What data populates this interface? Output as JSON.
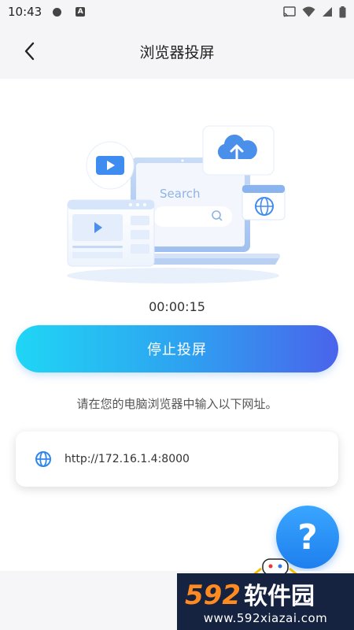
{
  "status_bar": {
    "time": "10:43",
    "a_badge": "A",
    "icons": [
      "record-dot-icon",
      "a-badge-icon",
      "cast-icon",
      "wifi-icon",
      "signal-icon",
      "battery-icon"
    ]
  },
  "header": {
    "title": "浏览器投屏",
    "back_icon": "chevron-left-icon"
  },
  "illustration": {
    "search_placeholder": "Search",
    "icons": [
      "play-icon",
      "cloud-upload-icon",
      "globe-icon",
      "search-icon"
    ]
  },
  "timer": "00:00:15",
  "stop_button": {
    "label": "停止投屏"
  },
  "hint": "请在您的电脑浏览器中输入以下网址。",
  "url_card": {
    "icon": "globe-icon",
    "url": "http://172.16.1.4:8000"
  },
  "help_button": {
    "label": "?"
  },
  "watermark": {
    "number": "592",
    "name": "软件园",
    "site": "www.592xiazai.com"
  },
  "colors": {
    "accent_start": "#1fd6f5",
    "accent_end": "#4a63ec",
    "help_blue": "#2b8ff5",
    "header_bg": "#f5f5f7"
  }
}
